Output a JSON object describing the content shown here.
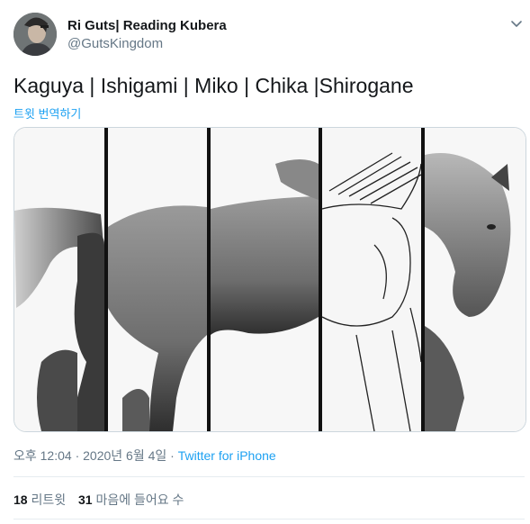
{
  "author": {
    "name": "Ri Guts| Reading Kubera",
    "handle": "@GutsKingdom"
  },
  "tweet": {
    "text": "Kaguya | Ishigami | Miko | Chika |Shirogane",
    "translate_label": "트윗 번역하기"
  },
  "meta": {
    "time": "오후 12:04",
    "separator": " · ",
    "date": "2020년 6월 4일",
    "source": "Twitter for iPhone"
  },
  "stats": {
    "retweets_count": "18",
    "retweets_label": "리트윗",
    "likes_count": "31",
    "likes_label": "마음에 들어요 수"
  },
  "icons": {
    "menu": "chevron-down-icon"
  },
  "colors": {
    "link": "#1da1f2",
    "secondary_text": "#657786",
    "divider": "#e6ecf0"
  }
}
